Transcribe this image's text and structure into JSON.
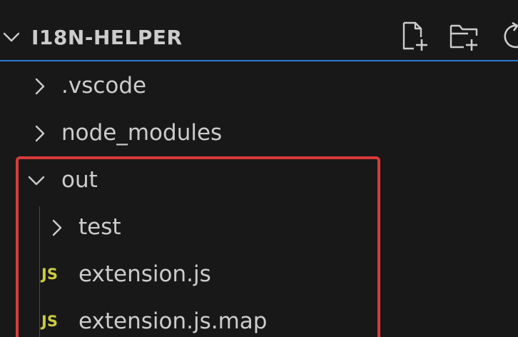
{
  "explorer": {
    "section_title": "I18N-HELPER",
    "actions": [
      {
        "name": "new-file",
        "icon": "new-file-icon"
      },
      {
        "name": "new-folder",
        "icon": "new-folder-icon"
      },
      {
        "name": "refresh",
        "icon": "refresh-icon"
      }
    ],
    "tree": [
      {
        "label": ".vscode",
        "kind": "folder",
        "expanded": false
      },
      {
        "label": "node_modules",
        "kind": "folder",
        "expanded": false
      },
      {
        "label": "out",
        "kind": "folder",
        "expanded": true
      },
      {
        "label": "test",
        "kind": "folder",
        "expanded": false
      },
      {
        "label": "extension.js",
        "kind": "file",
        "badge": "JS"
      },
      {
        "label": "extension.js.map",
        "kind": "file",
        "badge": "JS"
      }
    ]
  },
  "colors": {
    "background": "#181818",
    "text": "#cccccc",
    "js_badge": "#cbcb41",
    "focus_border": "#2b79d8",
    "highlight_box": "#d93a3a"
  }
}
